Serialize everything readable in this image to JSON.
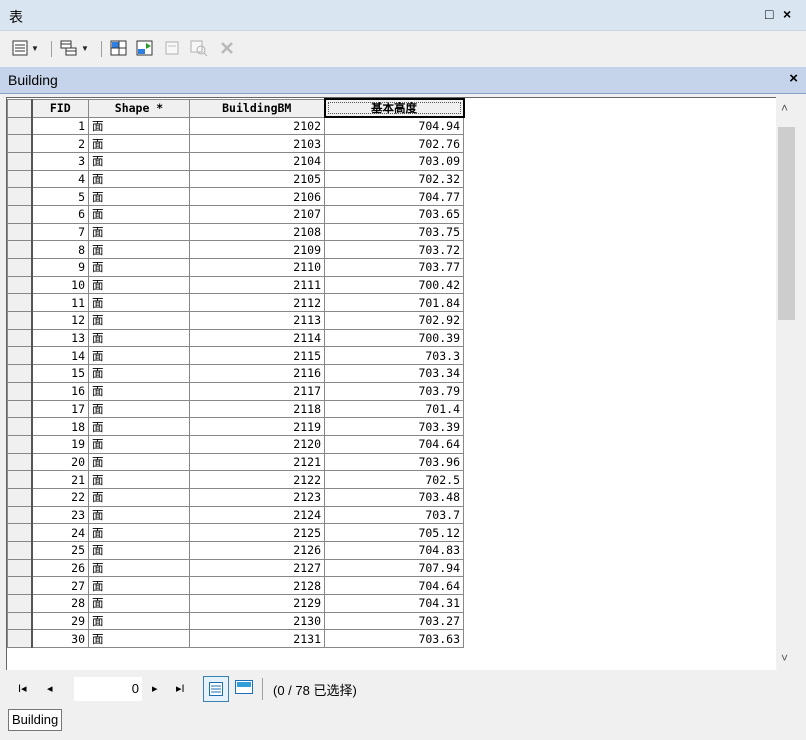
{
  "window": {
    "title": "表",
    "restore_glyph": "□",
    "close_glyph": "×"
  },
  "toolbar": {
    "icons": [
      "table-options-icon",
      "related-tables-icon",
      "select-by-attributes-icon",
      "switch-selection-icon",
      "clear-selection-icon",
      "zoom-to-selected-icon",
      "delete-selected-icon"
    ]
  },
  "tab": {
    "name": "Building",
    "close_glyph": "×"
  },
  "grid": {
    "columns": [
      "FID",
      "Shape *",
      "BuildingBM",
      "基本高度"
    ],
    "shape_value": "面",
    "rows": [
      [
        "1",
        "面",
        "2102",
        "704.94"
      ],
      [
        "2",
        "面",
        "2103",
        "702.76"
      ],
      [
        "3",
        "面",
        "2104",
        "703.09"
      ],
      [
        "4",
        "面",
        "2105",
        "702.32"
      ],
      [
        "5",
        "面",
        "2106",
        "704.77"
      ],
      [
        "6",
        "面",
        "2107",
        "703.65"
      ],
      [
        "7",
        "面",
        "2108",
        "703.75"
      ],
      [
        "8",
        "面",
        "2109",
        "703.72"
      ],
      [
        "9",
        "面",
        "2110",
        "703.77"
      ],
      [
        "10",
        "面",
        "2111",
        "700.42"
      ],
      [
        "11",
        "面",
        "2112",
        "701.84"
      ],
      [
        "12",
        "面",
        "2113",
        "702.92"
      ],
      [
        "13",
        "面",
        "2114",
        "700.39"
      ],
      [
        "14",
        "面",
        "2115",
        "703.3"
      ],
      [
        "15",
        "面",
        "2116",
        "703.34"
      ],
      [
        "16",
        "面",
        "2117",
        "703.79"
      ],
      [
        "17",
        "面",
        "2118",
        "701.4"
      ],
      [
        "18",
        "面",
        "2119",
        "703.39"
      ],
      [
        "19",
        "面",
        "2120",
        "704.64"
      ],
      [
        "20",
        "面",
        "2121",
        "703.96"
      ],
      [
        "21",
        "面",
        "2122",
        "702.5"
      ],
      [
        "22",
        "面",
        "2123",
        "703.48"
      ],
      [
        "23",
        "面",
        "2124",
        "703.7"
      ],
      [
        "24",
        "面",
        "2125",
        "705.12"
      ],
      [
        "25",
        "面",
        "2126",
        "704.83"
      ],
      [
        "26",
        "面",
        "2127",
        "707.94"
      ],
      [
        "27",
        "面",
        "2128",
        "704.64"
      ],
      [
        "28",
        "面",
        "2129",
        "704.31"
      ],
      [
        "29",
        "面",
        "2130",
        "703.27"
      ],
      [
        "30",
        "面",
        "2131",
        "703.63"
      ]
    ]
  },
  "scrollbar": {
    "up": "˄",
    "down": "˅"
  },
  "navigator": {
    "first": "I◂",
    "prev": "◂",
    "current_record": "0",
    "next": "▸",
    "last": "▸I",
    "selection_info": "(0 / 78 已选择)"
  },
  "bottom_tab": {
    "label": "Building"
  },
  "colors": {
    "titlebar": "#dae5f2",
    "tabbar": "#c5d4ea",
    "grid_border": "#888888"
  }
}
